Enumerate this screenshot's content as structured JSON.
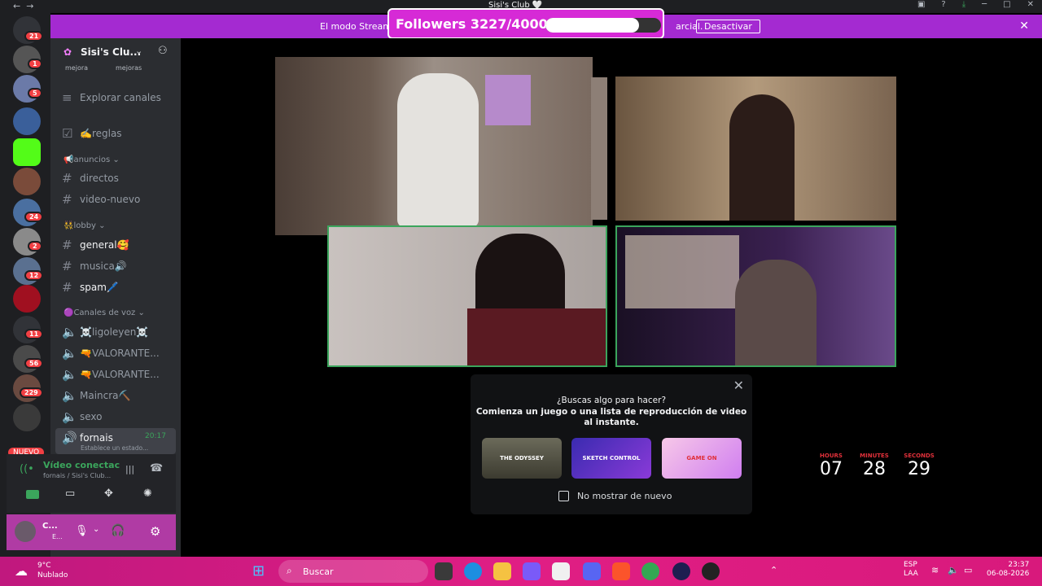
{
  "window": {
    "title": "Sisi's Club 🤍",
    "nav_back": "←",
    "nav_fwd": "→"
  },
  "banner": {
    "text_left": "El modo Stream",
    "text_right": "arcial.",
    "button": "Desactivar",
    "close": "✕"
  },
  "followers": {
    "label": "Followers 3227/4000",
    "current": 3227,
    "goal": 4000
  },
  "guilds": {
    "badges": [
      "21",
      "1",
      "5",
      "24",
      "2",
      "12",
      "11",
      "56",
      "229"
    ],
    "nuevo": "NUEVO"
  },
  "server": {
    "name": "Sisi's Clu...",
    "sub_left": "mejora",
    "sub_right": "mejoras",
    "explore": "Explorar canales",
    "rules": "✍️reglas",
    "cat_anuncios": "📢anuncios ⌄",
    "ch_directos": "directos",
    "ch_video_nuevo": "video-nuevo",
    "cat_lobby": "👯lobby ⌄",
    "ch_general": "general🥰",
    "ch_musica": "musica🔊",
    "ch_spam": "spam🖊️",
    "cat_voz": "🟣Canales de voz ⌄",
    "vc1": "☠️ligoleyen☠️",
    "vc2": "🔫VALORANTE...",
    "vc3": "🔫VALORANTE...",
    "vc4": "Maincra⛏️",
    "vc5": "sexo",
    "vc6": "fornais",
    "vc6_time": "20:17",
    "vc6_status": "Establece un estado..."
  },
  "voice": {
    "title": "Vídeo conectac",
    "sub": "fornais / Sisi's Club..."
  },
  "user": {
    "name": "C...",
    "status": "E..."
  },
  "popup": {
    "line1": "¿Buscas algo para hacer?",
    "line2": "Comienza un juego o una lista de reproducción de video",
    "line3": "al instante.",
    "card1": "THE ODYSSEY",
    "card2": "SKETCH CONTROL",
    "card3": "GAME ON",
    "checkbox": "No mostrar de nuevo"
  },
  "countdown": {
    "hours_label": "HOURS",
    "hours": "07",
    "minutes_label": "MINUTES",
    "minutes": "28",
    "seconds_label": "SECONDS",
    "seconds": "29"
  },
  "taskbar": {
    "temp": "9°C",
    "weather": "Nublado",
    "search": "Buscar",
    "lang1": "ESP",
    "lang2": "LAA",
    "time": "23:37",
    "date": "06-08-2026"
  },
  "colors": {
    "accent": "#a42ad1",
    "speaking": "#3ba55c",
    "taskbar": "#e01e84"
  }
}
